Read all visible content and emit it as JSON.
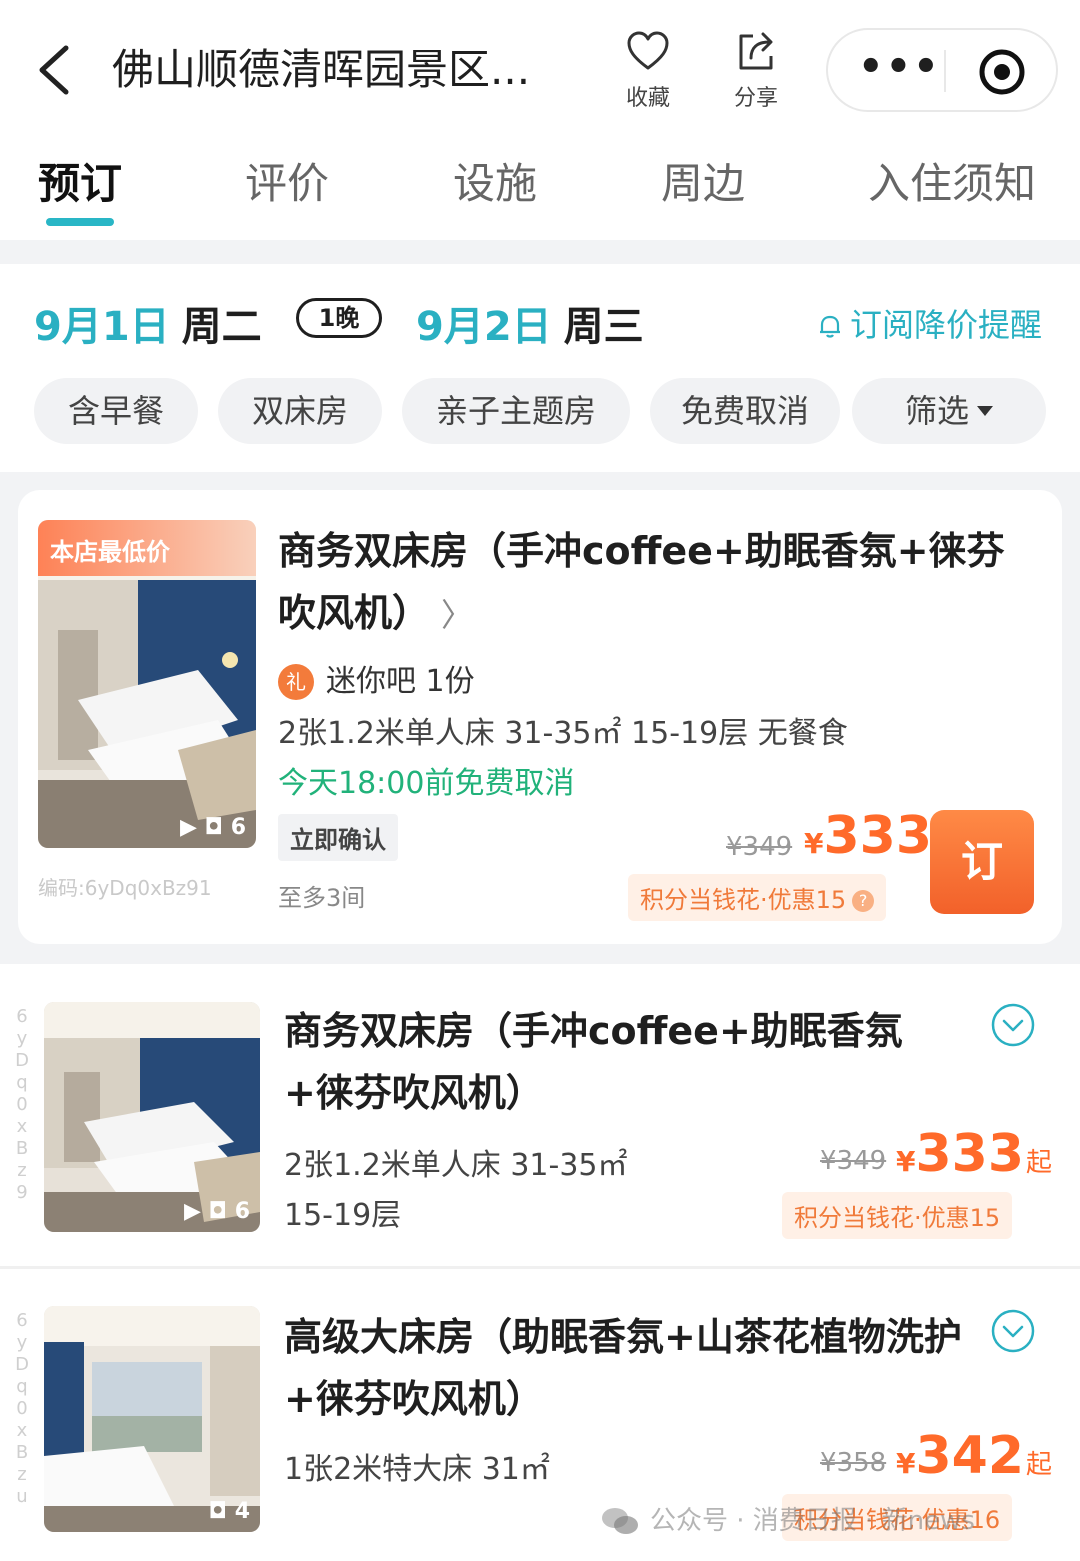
{
  "header": {
    "title": "佛山顺德清晖园景区...",
    "favorite_label": "收藏",
    "share_label": "分享"
  },
  "tabs": [
    "预订",
    "评价",
    "设施",
    "周边",
    "入住须知"
  ],
  "dates": {
    "checkin_date": "9月1日",
    "checkin_weekday": "周二",
    "nights": "1晚",
    "checkout_date": "9月2日",
    "checkout_weekday": "周三",
    "subscribe_label": "订阅降价提醒"
  },
  "filter_chips": [
    "含早餐",
    "双床房",
    "亲子主题房",
    "免费取消",
    "筛选"
  ],
  "featured": {
    "badge": "本店最低价",
    "photo_count": "6",
    "code": "编码:6yDq0xBz91",
    "name": "商务双床房（手冲coffee+助眠香氛+徕芬吹风机）",
    "gift_icon": "礼",
    "gift": "迷你吧 1份",
    "spec": "2张1.2米单人床   31-35㎡   15-19层   无餐食",
    "cancel": "今天18:00前免费取消",
    "confirm": "立即确认",
    "max_rooms": "至多3间",
    "original_price": "¥349",
    "currency": "¥",
    "price": "333",
    "promo": "积分当钱花·优惠15",
    "promo_help": "?",
    "book_label": "订"
  },
  "rooms": [
    {
      "side_code": "6yDq0xBz9",
      "photo_count": "6",
      "name": "商务双床房（手冲coffee+助眠香氛+徕芬吹风机）",
      "spec_line1": "2张1.2米单人床   31-35㎡",
      "spec_line2": "15-19层",
      "original_price": "¥349",
      "currency": "¥",
      "price": "333",
      "price_suffix": "起",
      "promo": "积分当钱花·优惠15"
    },
    {
      "side_code": "6yDq0xBzu",
      "photo_count": "4",
      "name": "高级大床房（助眠香氛+山茶花植物洗护+徕芬吹风机）",
      "spec_line1": "1张2米特大床   31㎡",
      "original_price": "¥358",
      "currency": "¥",
      "price": "342",
      "price_suffix": "起",
      "promo": "积分当钱花·优惠16"
    }
  ],
  "watermark": "公众号 · 消费日报 · 新news",
  "colors": {
    "accent": "#2ab0c2",
    "price": "#ff6a2a",
    "cancel": "#21b27a"
  }
}
